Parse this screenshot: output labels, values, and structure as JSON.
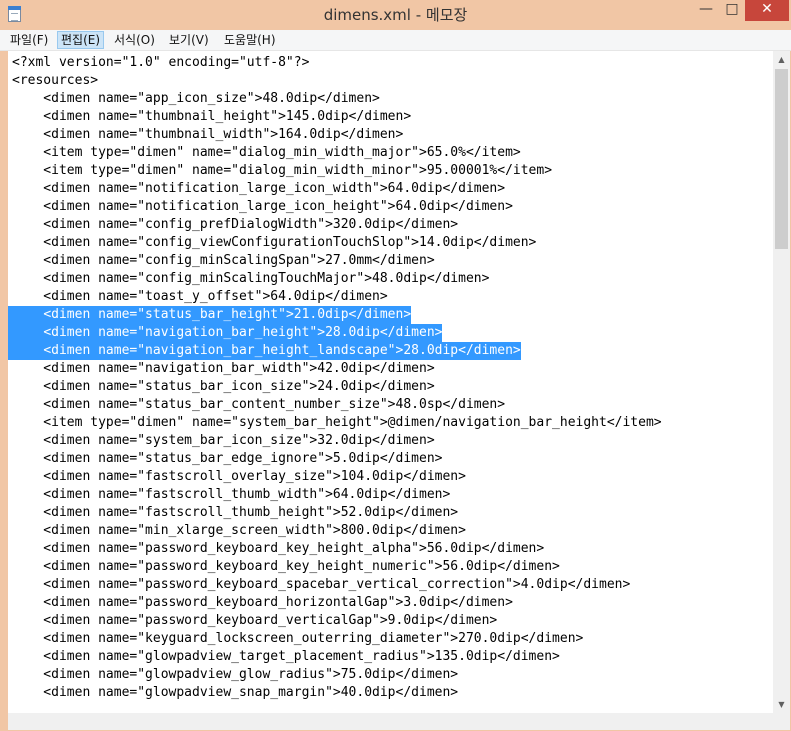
{
  "window": {
    "title": "dimens.xml - 메모장",
    "minimize_glyph": "—",
    "maximize_glyph": "□",
    "close_glyph": "✕"
  },
  "menu": [
    "파일(F)",
    "편집(E)",
    "서식(O)",
    "보기(V)",
    "도움말(H)"
  ],
  "menu_active_index": 1,
  "lines": [
    {
      "text": "<?xml version=\"1.0\" encoding=\"utf-8\"?>",
      "selected": false
    },
    {
      "text": "<resources>",
      "selected": false
    },
    {
      "text": "    <dimen name=\"app_icon_size\">48.0dip</dimen>",
      "selected": false
    },
    {
      "text": "    <dimen name=\"thumbnail_height\">145.0dip</dimen>",
      "selected": false
    },
    {
      "text": "    <dimen name=\"thumbnail_width\">164.0dip</dimen>",
      "selected": false
    },
    {
      "text": "    <item type=\"dimen\" name=\"dialog_min_width_major\">65.0%</item>",
      "selected": false
    },
    {
      "text": "    <item type=\"dimen\" name=\"dialog_min_width_minor\">95.00001%</item>",
      "selected": false
    },
    {
      "text": "    <dimen name=\"notification_large_icon_width\">64.0dip</dimen>",
      "selected": false
    },
    {
      "text": "    <dimen name=\"notification_large_icon_height\">64.0dip</dimen>",
      "selected": false
    },
    {
      "text": "    <dimen name=\"config_prefDialogWidth\">320.0dip</dimen>",
      "selected": false
    },
    {
      "text": "    <dimen name=\"config_viewConfigurationTouchSlop\">14.0dip</dimen>",
      "selected": false
    },
    {
      "text": "    <dimen name=\"config_minScalingSpan\">27.0mm</dimen>",
      "selected": false
    },
    {
      "text": "    <dimen name=\"config_minScalingTouchMajor\">48.0dip</dimen>",
      "selected": false
    },
    {
      "text": "    <dimen name=\"toast_y_offset\">64.0dip</dimen>",
      "selected": false
    },
    {
      "text": "    <dimen name=\"status_bar_height\">21.0dip</dimen>",
      "selected": true
    },
    {
      "text": "    <dimen name=\"navigation_bar_height\">28.0dip</dimen>",
      "selected": true
    },
    {
      "text": "    <dimen name=\"navigation_bar_height_landscape\">28.0dip</dimen>",
      "selected": true
    },
    {
      "text": "    <dimen name=\"navigation_bar_width\">42.0dip</dimen>",
      "selected": false
    },
    {
      "text": "    <dimen name=\"status_bar_icon_size\">24.0dip</dimen>",
      "selected": false
    },
    {
      "text": "    <dimen name=\"status_bar_content_number_size\">48.0sp</dimen>",
      "selected": false
    },
    {
      "text": "    <item type=\"dimen\" name=\"system_bar_height\">@dimen/navigation_bar_height</item>",
      "selected": false
    },
    {
      "text": "    <dimen name=\"system_bar_icon_size\">32.0dip</dimen>",
      "selected": false
    },
    {
      "text": "    <dimen name=\"status_bar_edge_ignore\">5.0dip</dimen>",
      "selected": false
    },
    {
      "text": "    <dimen name=\"fastscroll_overlay_size\">104.0dip</dimen>",
      "selected": false
    },
    {
      "text": "    <dimen name=\"fastscroll_thumb_width\">64.0dip</dimen>",
      "selected": false
    },
    {
      "text": "    <dimen name=\"fastscroll_thumb_height\">52.0dip</dimen>",
      "selected": false
    },
    {
      "text": "    <dimen name=\"min_xlarge_screen_width\">800.0dip</dimen>",
      "selected": false
    },
    {
      "text": "    <dimen name=\"password_keyboard_key_height_alpha\">56.0dip</dimen>",
      "selected": false
    },
    {
      "text": "    <dimen name=\"password_keyboard_key_height_numeric\">56.0dip</dimen>",
      "selected": false
    },
    {
      "text": "    <dimen name=\"password_keyboard_spacebar_vertical_correction\">4.0dip</dimen>",
      "selected": false
    },
    {
      "text": "    <dimen name=\"password_keyboard_horizontalGap\">3.0dip</dimen>",
      "selected": false
    },
    {
      "text": "    <dimen name=\"password_keyboard_verticalGap\">9.0dip</dimen>",
      "selected": false
    },
    {
      "text": "    <dimen name=\"keyguard_lockscreen_outerring_diameter\">270.0dip</dimen>",
      "selected": false
    },
    {
      "text": "    <dimen name=\"glowpadview_target_placement_radius\">135.0dip</dimen>",
      "selected": false
    },
    {
      "text": "    <dimen name=\"glowpadview_glow_radius\">75.0dip</dimen>",
      "selected": false
    },
    {
      "text": "    <dimen name=\"glowpadview_snap_margin\">40.0dip</dimen>",
      "selected": false
    }
  ],
  "colors": {
    "selection": "#3399ff",
    "selection_text": "#ffffff",
    "frame": "#f1c6a5",
    "close_button": "#c7463b"
  },
  "icons": {
    "app": "notepad-icon",
    "scroll_up": "triangle-up-icon",
    "scroll_down": "triangle-down-icon"
  }
}
